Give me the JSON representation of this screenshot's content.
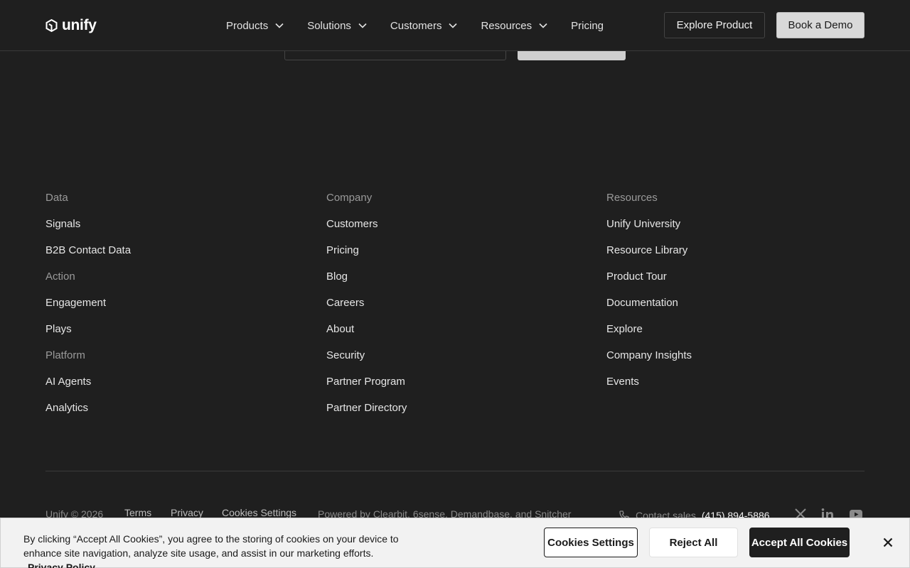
{
  "header": {
    "logo_text": "unify",
    "nav": [
      {
        "label": "Products"
      },
      {
        "label": "Solutions"
      },
      {
        "label": "Customers"
      },
      {
        "label": "Resources"
      },
      {
        "label": "Pricing"
      }
    ],
    "explore_label": "Explore Product",
    "demo_label": "Book a Demo"
  },
  "footer": {
    "col1": {
      "groups": [
        {
          "heading": "Data",
          "links": [
            "Signals",
            "B2B Contact Data"
          ]
        },
        {
          "heading": "Action",
          "links": [
            "Engagement",
            "Plays"
          ]
        },
        {
          "heading": "Platform",
          "links": [
            "AI Agents",
            "Analytics"
          ]
        }
      ]
    },
    "col2": {
      "heading": "Company",
      "links": [
        "Customers",
        "Pricing",
        "Blog",
        "Careers",
        "About",
        "Security",
        "Partner Program",
        "Partner Directory"
      ]
    },
    "col3": {
      "heading": "Resources",
      "links": [
        "Unify University",
        "Resource Library",
        "Product Tour",
        "Documentation",
        "Explore",
        "Company Insights",
        "Events"
      ]
    },
    "bottom": {
      "copyright": "Unify © 2026",
      "terms": "Terms",
      "privacy": "Privacy",
      "cookies_settings": "Cookies Settings",
      "powered_by": "Powered by Clearbit, 6sense, Demandbase, and Snitcher",
      "contact_label": "Contact sales",
      "phone": "(415) 894-5886",
      "social_icons": [
        "x-icon",
        "linkedin-icon",
        "youtube-icon"
      ]
    }
  },
  "cookie_banner": {
    "text": "By clicking “Accept All Cookies”, you agree to the storing of cookies on your device to enhance site navigation, analyze site usage, and assist in our marketing efforts.",
    "policy_link": "Privacy Policy",
    "settings_label": "Cookies Settings",
    "reject_label": "Reject All",
    "accept_label": "Accept All Cookies"
  },
  "colors": {
    "background": "#1f1f1f",
    "muted_text": "#9a9a9a",
    "cookie_bg": "#f2f2f2"
  }
}
